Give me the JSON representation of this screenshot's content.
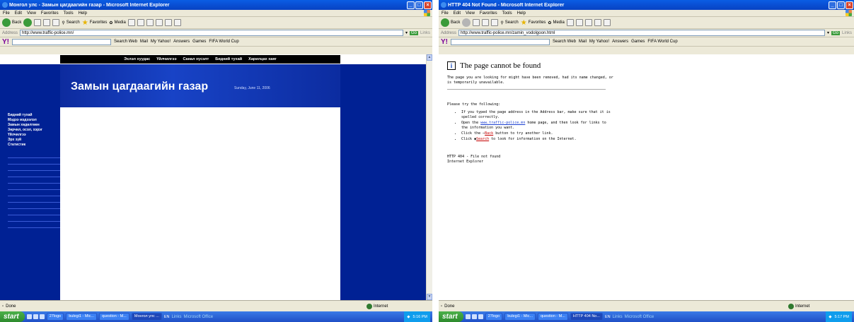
{
  "screen1": {
    "title": "Монгол улс - Замын цагдаагийн газар - Microsoft Internet Explorer",
    "menu": [
      "File",
      "Edit",
      "View",
      "Favorites",
      "Tools",
      "Help"
    ],
    "toolbar": {
      "back": "Back",
      "search": "Search",
      "favorites": "Favorites",
      "media": "Media"
    },
    "address_label": "Address",
    "address": "http://www.traffic-police.mn/",
    "go": "Go",
    "links": "Links",
    "ytoolbar": {
      "logo": "Y!",
      "search_web": "Search Web",
      "mail": "Mail",
      "yahoo": "My Yahoo!",
      "answers": "Answers",
      "games": "Games",
      "fifa": "FIFA World Cup"
    },
    "page": {
      "nav": [
        "Эхлэл хуудас",
        "Үйлчилгээ",
        "Санал хүсэлт",
        "Бидний тухай",
        "Харилцах хаяг"
      ],
      "title": "Замын цагдаагийн газар",
      "date": "Sunday, June 11, 2006",
      "menu": [
        "Бидний тухай",
        "Мэдээ мэдээлэл",
        "Замын хөдөлгөөн",
        "Зөрчил, осол, хэрэг",
        "Үйлчилгээ",
        "Эрх зүй",
        "Статистик"
      ]
    },
    "status_left": "Done",
    "status_zone": "Internet",
    "taskbar": {
      "start": "start",
      "buttons": [
        "27logo",
        "bulegi1 - Mic...",
        "question - M...",
        "Монгол улс ..."
      ],
      "tray_text": [
        "EN",
        "Links",
        "Microsoft Office"
      ],
      "time": "5:16 PM"
    }
  },
  "screen2": {
    "title": "HTTP 404 Not Found - Microsoft Internet Explorer",
    "menu": [
      "File",
      "Edit",
      "View",
      "Favorites",
      "Tools",
      "Help"
    ],
    "toolbar": {
      "back": "Back",
      "search": "Search",
      "favorites": "Favorites",
      "media": "Media"
    },
    "address_label": "Address",
    "address": "http://www.traffic-police.mn/zamin_vodolgoon.html",
    "go": "Go",
    "links": "Links",
    "ytoolbar": {
      "logo": "Y!",
      "search_web": "Search Web",
      "mail": "Mail",
      "yahoo": "My Yahoo!",
      "answers": "Answers",
      "games": "Games",
      "fifa": "FIFA World Cup"
    },
    "page": {
      "heading": "The page cannot be found",
      "message": "The page you are looking for might have been removed, had its name changed, or is temporarily unavailable.",
      "try": "Please try the following:",
      "item1": "If you typed the page address in the Address bar, make sure that it is spelled correctly.",
      "item2_pre": "Open the",
      "item2_link": "www.traffic-police.mn",
      "item2_post": "home page, and then look for links to the information you want.",
      "item3_pre": "Click the",
      "item3_link": "Back",
      "item3_post": "button to try another link.",
      "item4_pre": "Click",
      "item4_link": "Search",
      "item4_post": "to look for information on the Internet.",
      "footer1": "HTTP 404 - File not found",
      "footer2": "Internet Explorer"
    },
    "status_left": "Done",
    "status_zone": "Internet",
    "taskbar": {
      "start": "start",
      "buttons": [
        "27logo",
        "bulegi1 - Mic...",
        "question - M...",
        "HTTP 404 No..."
      ],
      "tray_text": [
        "EN",
        "Links",
        "Microsoft Office"
      ],
      "time": "5:17 PM"
    }
  }
}
